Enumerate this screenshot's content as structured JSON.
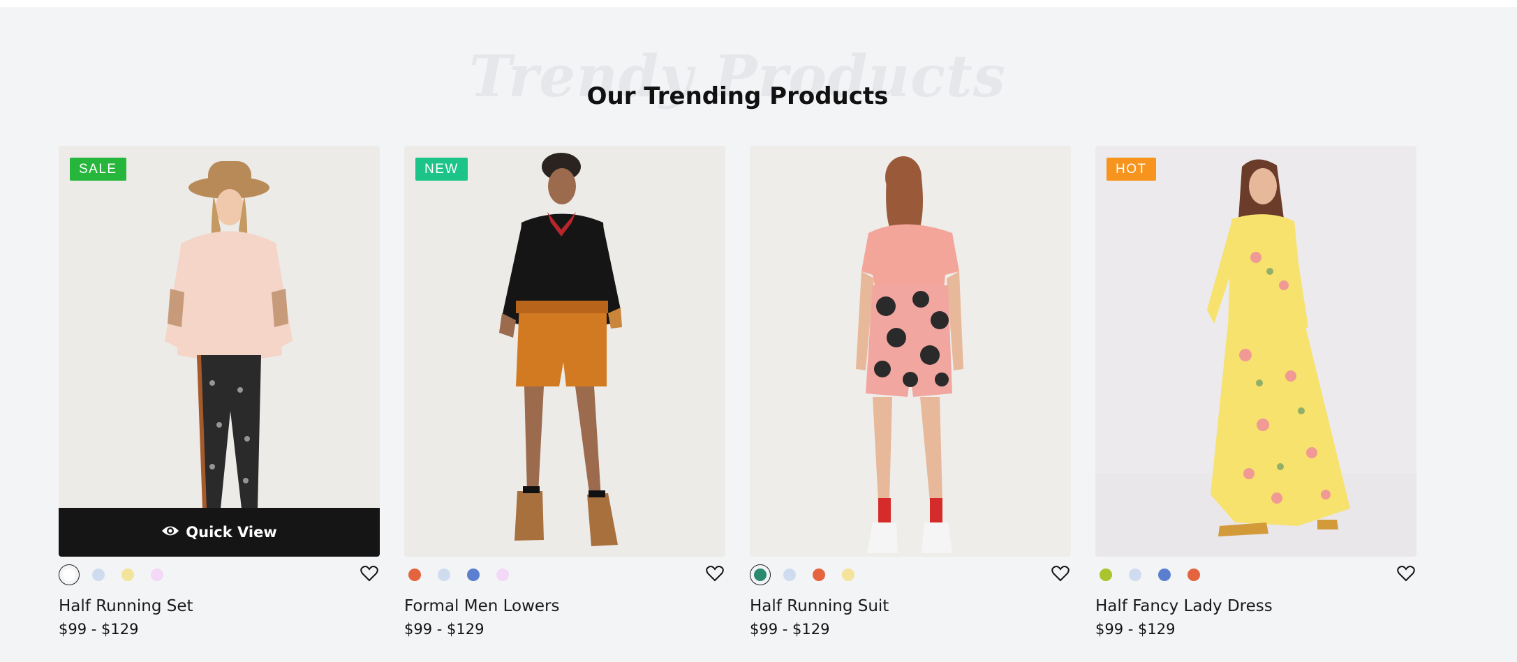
{
  "section": {
    "background_title": "Trendy Products",
    "title": "Our Trending Products"
  },
  "quick_view_label": "Quick View",
  "products": [
    {
      "name": "Half Running Set",
      "price": "$99 - $129",
      "badge": "SALE",
      "badge_color": "#27b63c",
      "swatches": [
        "#ffffff",
        "#cfdcef",
        "#f4e39a",
        "#f3d8f7"
      ],
      "active_swatch": 0
    },
    {
      "name": "Formal Men Lowers",
      "price": "$99 - $129",
      "badge": "NEW",
      "badge_color": "#1cc48a",
      "swatches": [
        "#e3643f",
        "#cfdcef",
        "#5b7fcf",
        "#f3d8f7"
      ],
      "active_swatch": null
    },
    {
      "name": "Half Running Suit",
      "price": "$99 - $129",
      "badge": "",
      "badge_color": "",
      "swatches": [
        "#2b8a6e",
        "#cfdcef",
        "#e3643f",
        "#f4e39a"
      ],
      "active_swatch": 0
    },
    {
      "name": "Half Fancy Lady Dress",
      "price": "$99 - $129",
      "badge": "HOT",
      "badge_color": "#f7941d",
      "swatches": [
        "#a9c42d",
        "#cfdcef",
        "#5b7fcf",
        "#e3643f"
      ],
      "active_swatch": null
    }
  ]
}
